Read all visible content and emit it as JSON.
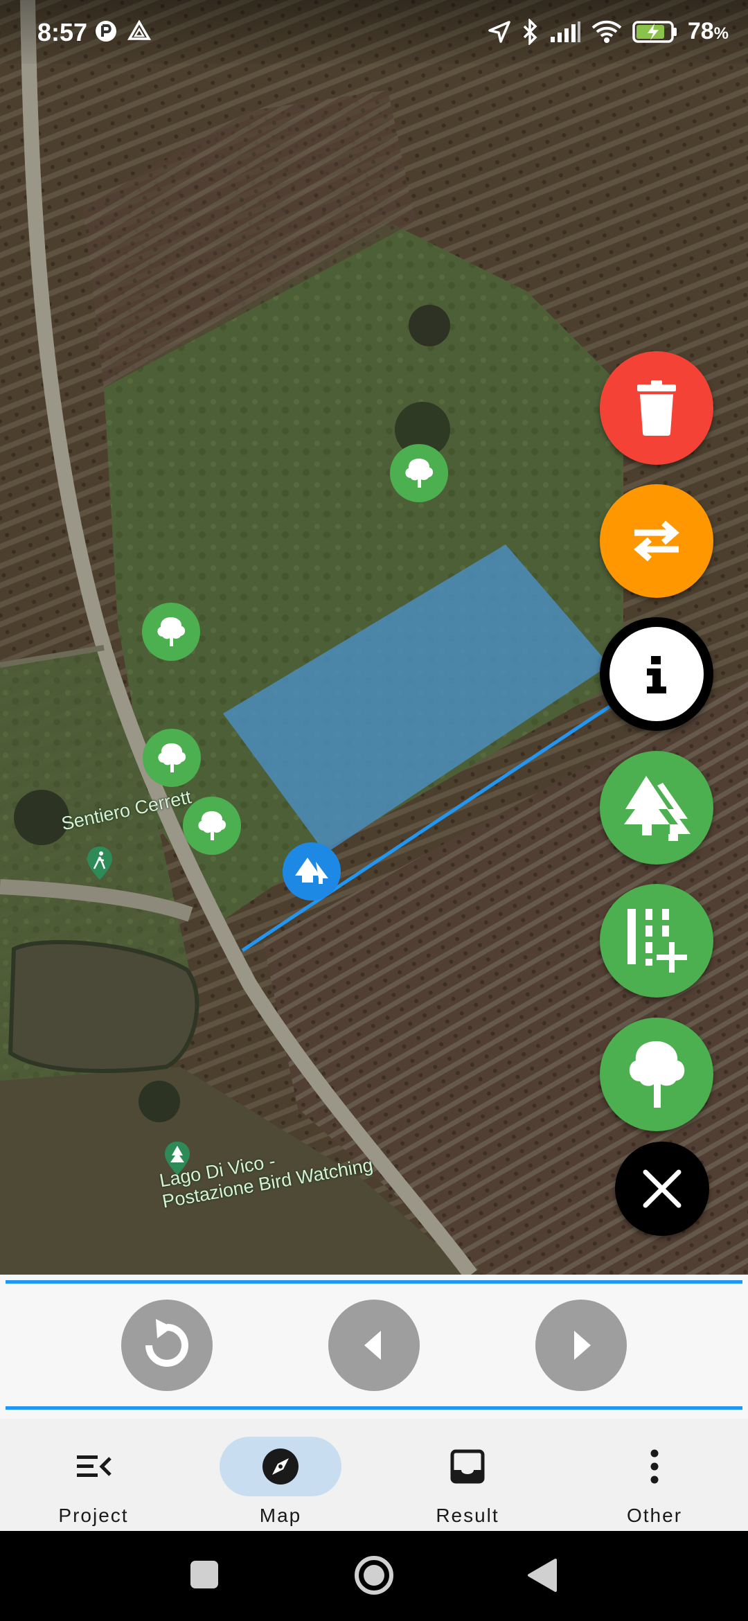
{
  "status_bar": {
    "time": "8:57",
    "battery": "78",
    "battery_unit": "%",
    "icons_left": [
      "media-icon",
      "drive-icon"
    ],
    "icons_right": [
      "location-icon",
      "bluetooth-icon",
      "signal-icon",
      "wifi-icon",
      "battery-charging-icon"
    ]
  },
  "map": {
    "labels": {
      "trail": "Sentiero Cerrett",
      "poi_line1": "Lago Di Vico -",
      "poi_line2": "Postazione Bird Watching"
    },
    "polygon_color": "#4a90c8",
    "line_color": "#2196f3"
  },
  "fabs": [
    {
      "name": "delete-button",
      "icon": "trash-icon",
      "color": "#f44336"
    },
    {
      "name": "swap-button",
      "icon": "swap-arrows-icon",
      "color": "#ff9800"
    },
    {
      "name": "info-button",
      "icon": "info-icon",
      "color": "#ffffff"
    },
    {
      "name": "add-forest-button",
      "icon": "forest-icon",
      "color": "#4caf50"
    },
    {
      "name": "add-row-button",
      "icon": "row-add-icon",
      "color": "#4caf50"
    },
    {
      "name": "add-tree-button",
      "icon": "tree-icon",
      "color": "#4caf50"
    },
    {
      "name": "close-button",
      "icon": "close-icon",
      "color": "#000000"
    }
  ],
  "controls": [
    "undo-icon",
    "previous-icon",
    "next-icon"
  ],
  "bottom_nav": {
    "items": [
      {
        "label": "Project",
        "icon": "project-list-icon"
      },
      {
        "label": "Map",
        "icon": "compass-icon",
        "active": true
      },
      {
        "label": "Result",
        "icon": "inbox-icon"
      },
      {
        "label": "Other",
        "icon": "more-vert-icon"
      }
    ]
  },
  "system_nav": [
    "recents-icon",
    "home-icon",
    "back-icon"
  ]
}
